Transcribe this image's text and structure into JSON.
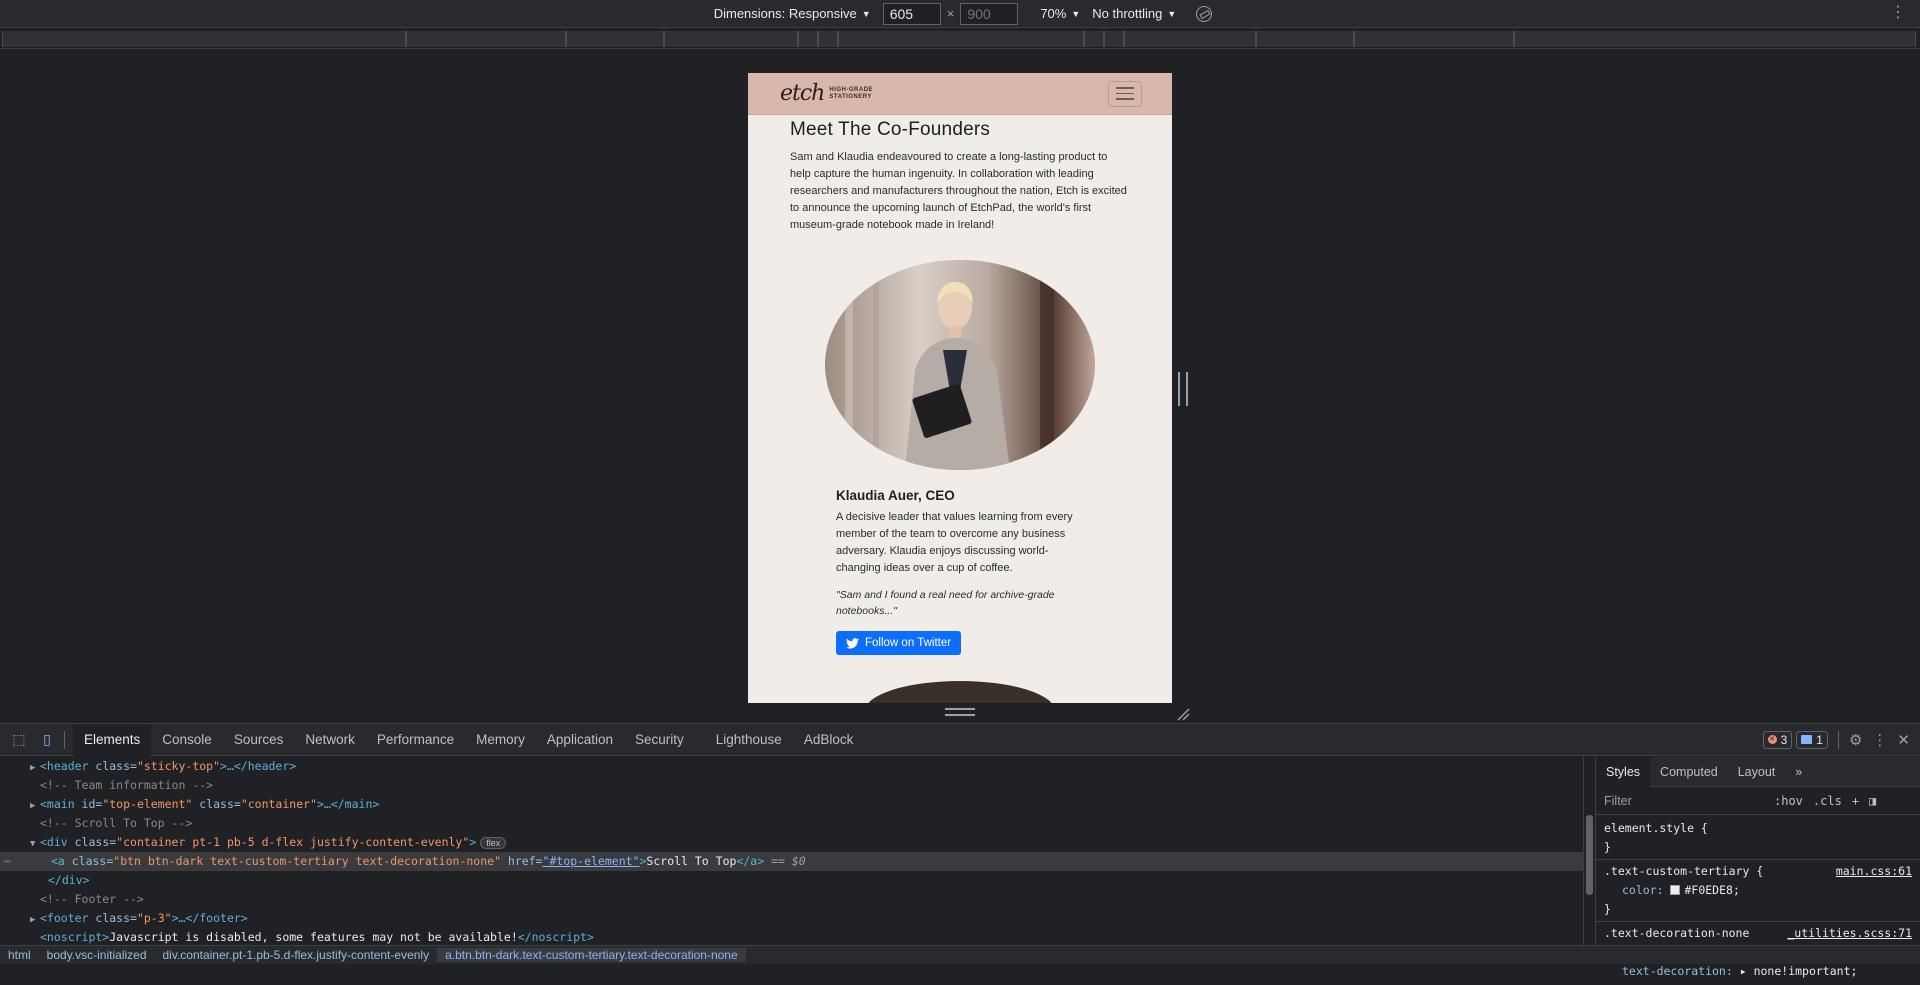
{
  "device_toolbar": {
    "dimensions_label": "Dimensions: Responsive",
    "width": "605",
    "height": "900",
    "times": "×",
    "zoom": "70%",
    "throttling": "No throttling"
  },
  "site": {
    "logo_mark": "etch",
    "logo_sub": "HIGH-GRADE STATIONERY",
    "title": "Meet The Co-Founders",
    "intro": "Sam and Klaudia endeavoured to create a long-lasting product to help capture the human ingenuity. In collaboration with leading researchers and manufacturers throughout the nation, Etch is excited to announce the upcoming launch of EtchPad, the world's first museum-grade notebook made in Ireland!",
    "founder": {
      "name": "Klaudia Auer, CEO",
      "bio": "A decisive leader that values learning from every member of the team to overcome any business adversary. Klaudia enjoys discussing world-changing ideas over a cup of coffee.",
      "quote": "\"Sam and I found a real need for archive-grade notebooks...\"",
      "twitter_label": "Follow on Twitter"
    }
  },
  "devtools": {
    "tabs": [
      "Elements",
      "Console",
      "Sources",
      "Network",
      "Performance",
      "Memory",
      "Application",
      "Security",
      "Lighthouse",
      "AdBlock"
    ],
    "errors": "3",
    "messages": "1",
    "elements": {
      "l1_tag_open": "<header",
      "l1_attr": " class=",
      "l1_val": "\"sticky-top\"",
      "l1_rest": ">…</header>",
      "l2_comment": "<!-- Team information -->",
      "l3_tag_open": "<main",
      "l3_attr1": " id=",
      "l3_val1": "\"top-element\"",
      "l3_attr2": " class=",
      "l3_val2": "\"container\"",
      "l3_rest": ">…</main>",
      "l4_comment": "<!-- Scroll To Top -->",
      "l5_tag_open": "<div",
      "l5_attr": " class=",
      "l5_val": "\"container pt-1 pb-5 d-flex justify-content-evenly\"",
      "l5_rest": ">",
      "l5_badge": "flex",
      "l6_tag_open": "<a",
      "l6_attr1": " class=",
      "l6_val1": "\"btn btn-dark text-custom-tertiary text-decoration-none\"",
      "l6_attr2": " href=",
      "l6_val2": "\"#top-element\"",
      "l6_gt": ">",
      "l6_text": "Scroll To Top",
      "l6_close": "</a>",
      "l6_dollar": " == $0",
      "l7_close": "</div>",
      "l8_comment": "<!-- Footer -->",
      "l9_tag_open": "<footer",
      "l9_attr": " class=",
      "l9_val": "\"p-3\"",
      "l9_rest": ">…</footer>",
      "l10_tag_open": "<noscript>",
      "l10_text": "Javascript is disabled, some features may not be available!",
      "l10_close": "</noscript>"
    },
    "styles": {
      "tabs": [
        "Styles",
        "Computed",
        "Layout"
      ],
      "filter_placeholder": "Filter",
      "hov": ":hov",
      "cls": ".cls",
      "rule1_selector": "element.style {",
      "rule1_close": "}",
      "rule2_selector": ".text-custom-tertiary {",
      "rule2_source": "main.css:61",
      "rule2_prop": "color:",
      "rule2_value": "#F0EDE8;",
      "rule2_close": "}",
      "rule3_selector": ".text-decoration-none",
      "rule3_source": "_utilities.scss:71",
      "rule3_brace": "{",
      "rule3_prop": "text-decoration:",
      "rule3_value": "▸ none!important;"
    },
    "breadcrumb": [
      "html",
      "body.vsc-initialized",
      "div.container.pt-1.pb-5.d-flex.justify-content-evenly",
      "a.btn.btn-dark.text-custom-tertiary.text-decoration-none"
    ]
  }
}
